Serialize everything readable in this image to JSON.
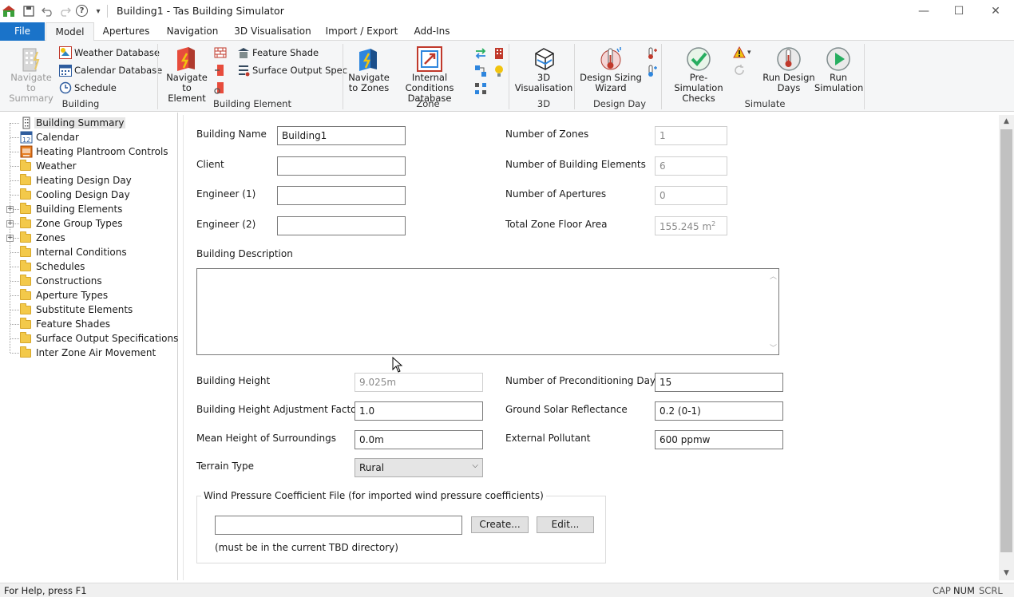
{
  "window": {
    "title": "Building1 - Tas Building Simulator",
    "controls": {
      "minimize": "—",
      "maximize": "☐",
      "close": "✕"
    }
  },
  "quick_access": {
    "help": "?",
    "dropdown": "▾"
  },
  "tabs": [
    {
      "label": "File",
      "active": false
    },
    {
      "label": "Model",
      "active": true
    },
    {
      "label": "Apertures",
      "active": false
    },
    {
      "label": "Navigation",
      "active": false
    },
    {
      "label": "3D Visualisation",
      "active": false
    },
    {
      "label": "Import / Export",
      "active": false
    },
    {
      "label": "Add-Ins",
      "active": false
    }
  ],
  "ribbon": {
    "building": {
      "label": "Building",
      "navigate_to_summary": "Navigate to Summary",
      "weather_database": "Weather Database",
      "calendar_database": "Calendar Database",
      "schedule": "Schedule"
    },
    "building_element": {
      "label": "Building Element",
      "navigate_to_element": "Navigate to Element",
      "feature_shade": "Feature Shade",
      "surface_output_spec": "Surface Output Spec"
    },
    "zone": {
      "label": "Zone",
      "navigate_to_zones": "Navigate to Zones",
      "internal_conditions_database": "Internal Conditions Database"
    },
    "three_d": {
      "label": "3D",
      "visualisation": "3D Visualisation"
    },
    "design_day": {
      "label": "Design Day",
      "sizing_wizard": "Design Sizing Wizard"
    },
    "simulate": {
      "label": "Simulate",
      "pre_simulation_checks": "Pre-Simulation Checks",
      "run_design_days": "Run Design Days",
      "run_simulation": "Run Simulation"
    }
  },
  "tree": {
    "items": [
      {
        "label": "Building Summary",
        "icon": "building-icon",
        "selected": true,
        "expandable": false
      },
      {
        "label": "Calendar",
        "icon": "calendar-icon",
        "selected": false,
        "expandable": false
      },
      {
        "label": "Heating Plantroom Controls",
        "icon": "plantroom-icon",
        "selected": false,
        "expandable": false
      },
      {
        "label": "Weather",
        "icon": "folder-icon",
        "selected": false,
        "expandable": false
      },
      {
        "label": "Heating Design Day",
        "icon": "folder-icon",
        "selected": false,
        "expandable": false
      },
      {
        "label": "Cooling Design Day",
        "icon": "folder-icon",
        "selected": false,
        "expandable": false
      },
      {
        "label": "Building Elements",
        "icon": "folder-icon",
        "selected": false,
        "expandable": true
      },
      {
        "label": "Zone Group Types",
        "icon": "folder-icon",
        "selected": false,
        "expandable": true
      },
      {
        "label": "Zones",
        "icon": "folder-icon",
        "selected": false,
        "expandable": true
      },
      {
        "label": "Internal Conditions",
        "icon": "folder-icon",
        "selected": false,
        "expandable": false
      },
      {
        "label": "Schedules",
        "icon": "folder-icon",
        "selected": false,
        "expandable": false
      },
      {
        "label": "Constructions",
        "icon": "folder-icon",
        "selected": false,
        "expandable": false
      },
      {
        "label": "Aperture Types",
        "icon": "folder-icon",
        "selected": false,
        "expandable": false
      },
      {
        "label": "Substitute Elements",
        "icon": "folder-icon",
        "selected": false,
        "expandable": false
      },
      {
        "label": "Feature Shades",
        "icon": "folder-icon",
        "selected": false,
        "expandable": false
      },
      {
        "label": "Surface Output Specifications",
        "icon": "folder-icon",
        "selected": false,
        "expandable": false
      },
      {
        "label": "Inter Zone Air Movement",
        "icon": "folder-icon",
        "selected": false,
        "expandable": false
      }
    ]
  },
  "form": {
    "building_name": {
      "label": "Building Name",
      "value": "Building1"
    },
    "client": {
      "label": "Client",
      "value": ""
    },
    "engineer1": {
      "label": "Engineer (1)",
      "value": ""
    },
    "engineer2": {
      "label": "Engineer (2)",
      "value": ""
    },
    "num_zones": {
      "label": "Number of Zones",
      "value": "1"
    },
    "num_elements": {
      "label": "Number of Building Elements",
      "value": "6"
    },
    "num_apertures": {
      "label": "Number of Apertures",
      "value": "0"
    },
    "floor_area": {
      "label": "Total Zone Floor Area",
      "value": "155.245 m",
      "unit_sup": "2"
    },
    "description": {
      "label": "Building Description",
      "value": ""
    },
    "building_height": {
      "label": "Building Height",
      "value": "9.025m"
    },
    "height_adjustment": {
      "label": "Building Height Adjustment Factor",
      "value": "1.0"
    },
    "mean_height": {
      "label": "Mean Height of Surroundings",
      "value": "0.0m"
    },
    "terrain_type": {
      "label": "Terrain Type",
      "value": "Rural"
    },
    "preconditioning_days": {
      "label": "Number of Preconditioning Days",
      "value": "15"
    },
    "ground_reflectance": {
      "label": "Ground Solar Reflectance",
      "value": "0.2 (0-1)"
    },
    "external_pollutant": {
      "label": "External Pollutant",
      "value": "600 ppmw"
    },
    "wind_pressure": {
      "legend": "Wind Pressure Coefficient File (for imported wind pressure coefficients)",
      "file_value": "",
      "create_label": "Create...",
      "edit_label": "Edit...",
      "note": "(must be in the current TBD directory)"
    }
  },
  "status_bar": {
    "help_text": "For Help, press F1",
    "cap": "CAP",
    "num": "NUM",
    "scrl": "SCRL"
  }
}
